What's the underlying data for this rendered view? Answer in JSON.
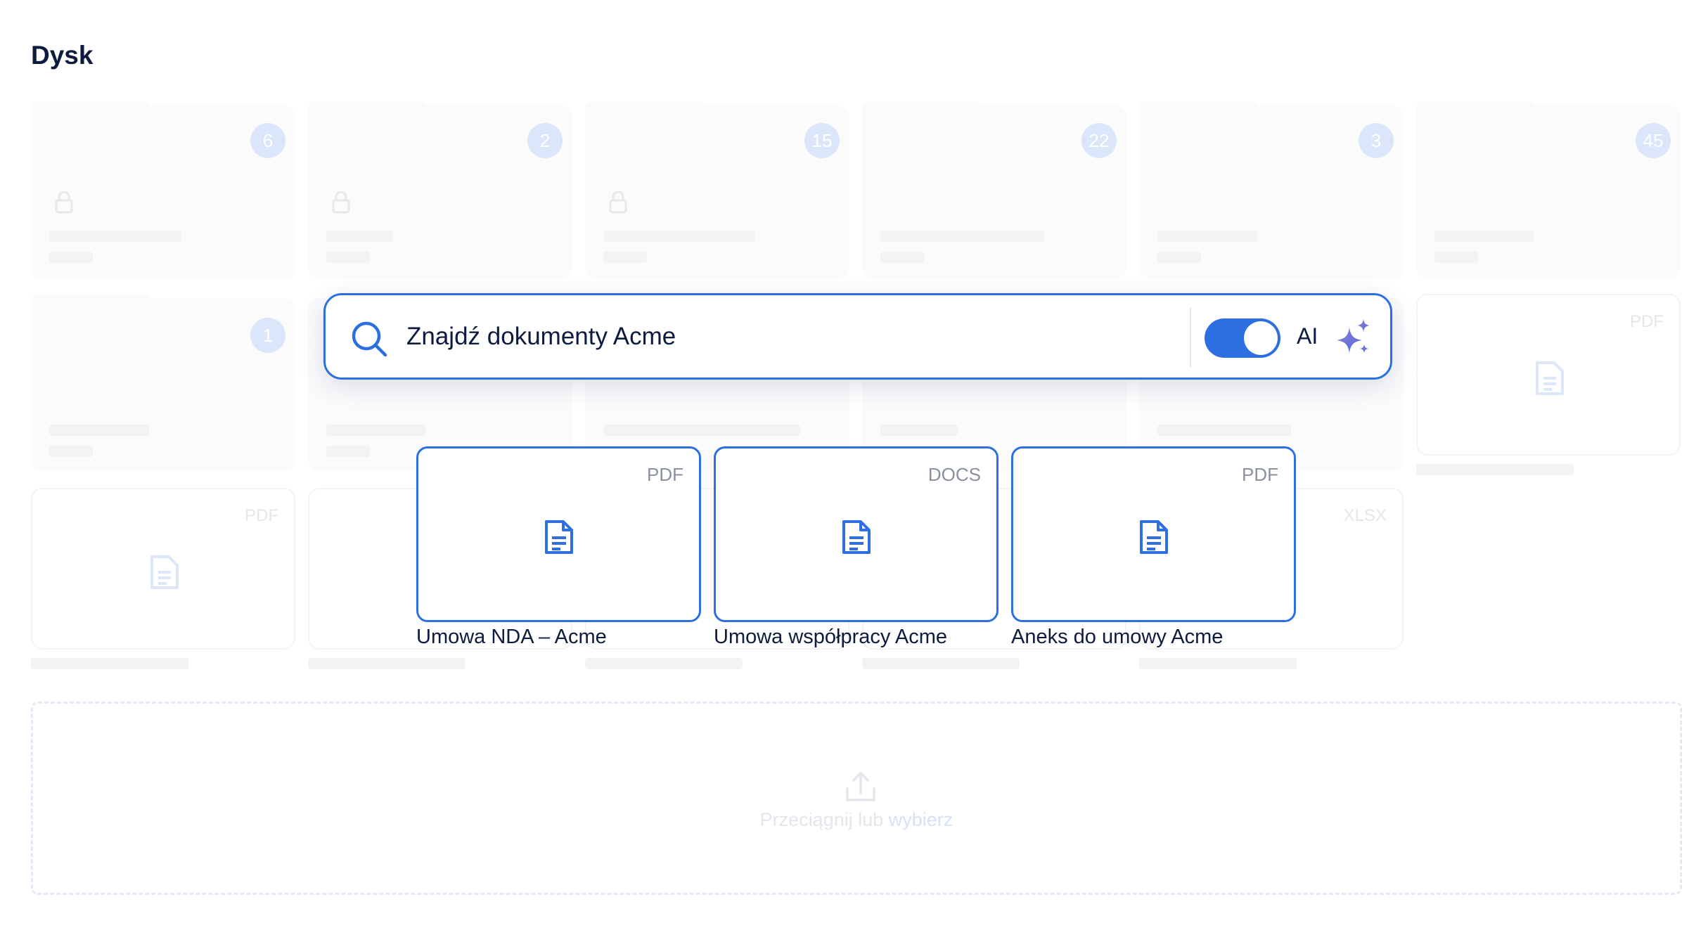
{
  "page": {
    "title": "Dysk"
  },
  "colors": {
    "accent": "#2d6fe0",
    "faded_badge": "#dbe6fb",
    "text": "#0d1b3e"
  },
  "folders": [
    {
      "count": "6",
      "locked": true
    },
    {
      "count": "2",
      "locked": true
    },
    {
      "count": "15",
      "locked": true
    },
    {
      "count": "22",
      "locked": false
    },
    {
      "count": "3",
      "locked": false
    },
    {
      "count": "45",
      "locked": false
    },
    {
      "count": "1",
      "locked": false
    }
  ],
  "background_files": [
    {
      "ext": "PDF"
    },
    {
      "ext": "PDF"
    },
    {
      "ext": "XLSX"
    }
  ],
  "search": {
    "query": "Znajdź dokumenty Acme",
    "ai_label": "AI",
    "ai_enabled": true
  },
  "results": [
    {
      "ext": "PDF",
      "name": "Umowa NDA – Acme"
    },
    {
      "ext": "DOCS",
      "name": "Umowa współpracy Acme"
    },
    {
      "ext": "PDF",
      "name": "Aneks do umowy Acme"
    }
  ],
  "upload": {
    "text": "Przeciągnij lub",
    "link": "wybierz"
  }
}
